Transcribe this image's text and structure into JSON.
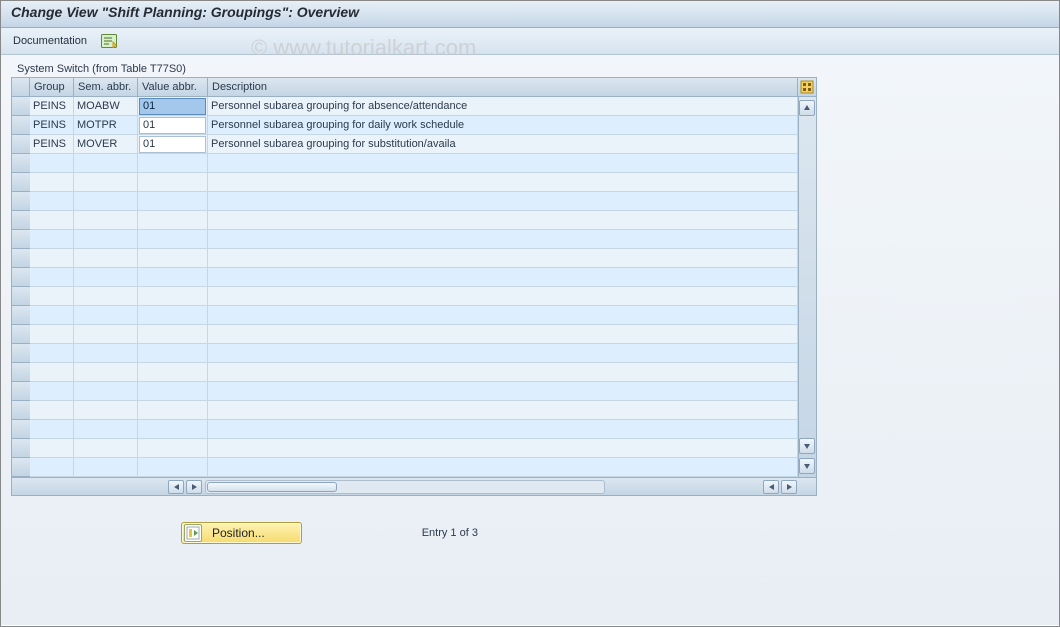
{
  "watermark": "© www.tutorialkart.com",
  "header": {
    "title": "Change View \"Shift Planning: Groupings\": Overview"
  },
  "toolbar": {
    "documentation_label": "Documentation"
  },
  "panel": {
    "title": "System Switch (from Table T77S0)"
  },
  "columns": {
    "group": "Group",
    "sem": "Sem. abbr.",
    "val": "Value abbr.",
    "desc": "Description"
  },
  "rows": [
    {
      "group": "PEINS",
      "sem": "MOABW",
      "val": "01",
      "desc": "Personnel subarea grouping for absence/attendance",
      "selected": true
    },
    {
      "group": "PEINS",
      "sem": "MOTPR",
      "val": "01",
      "desc": "Personnel subarea grouping for daily work schedule",
      "selected": false
    },
    {
      "group": "PEINS",
      "sem": "MOVER",
      "val": "01",
      "desc": "Personnel subarea grouping for substitution/availa",
      "selected": false
    }
  ],
  "empty_row_count": 17,
  "footer": {
    "position_label": "Position...",
    "entry_text": "Entry 1 of 3"
  }
}
